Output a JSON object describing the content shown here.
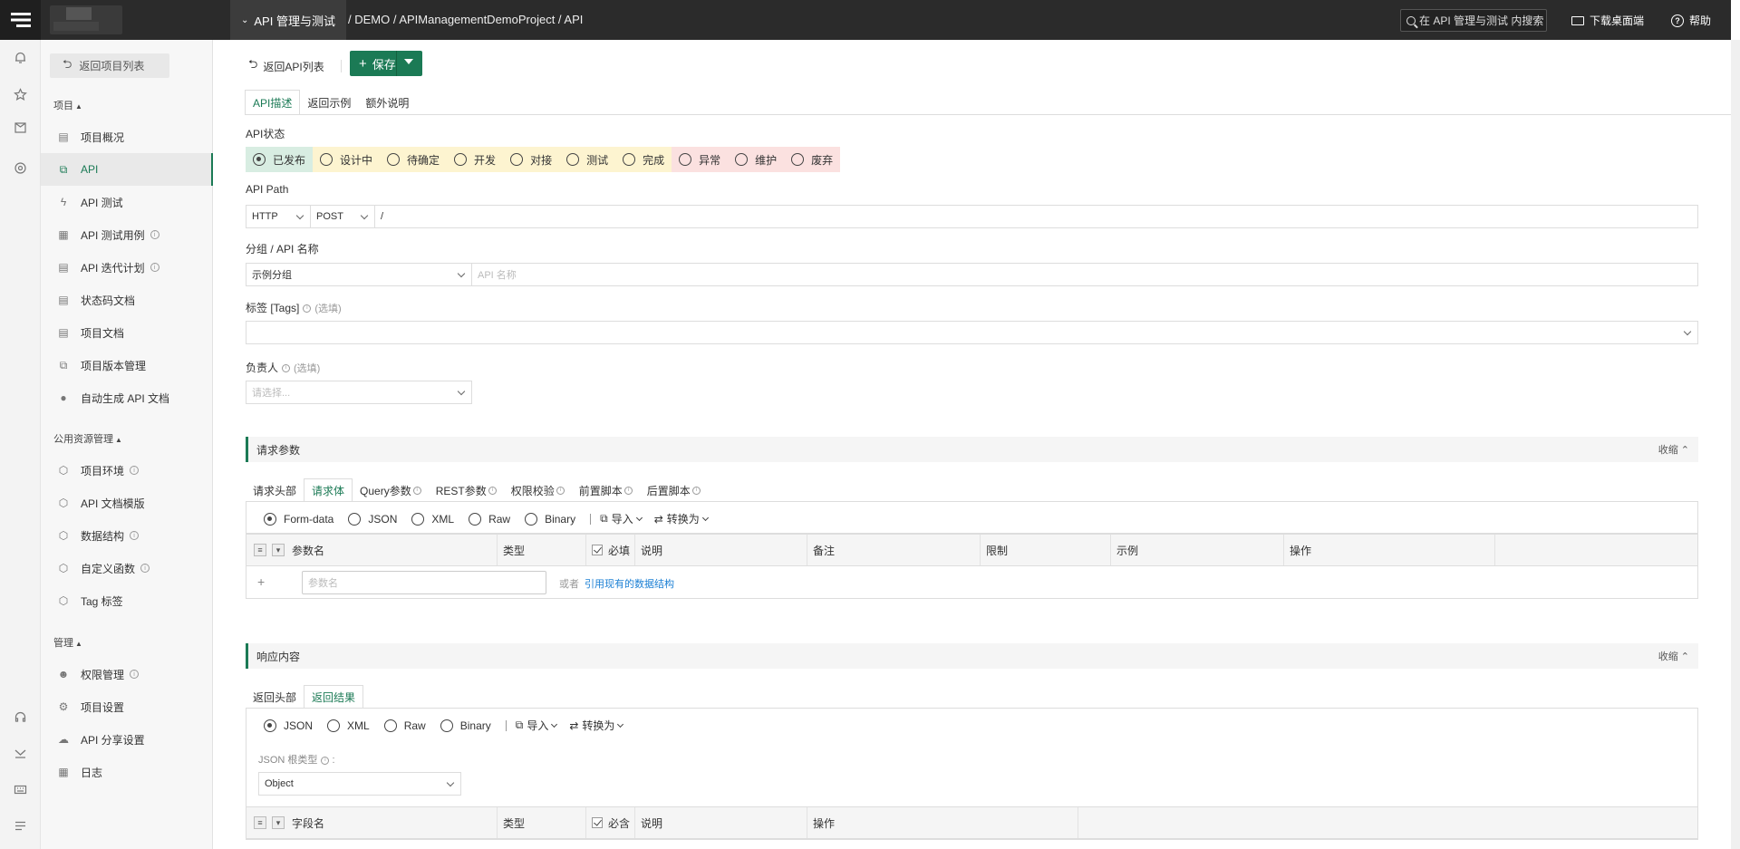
{
  "topbar": {
    "project_selector": "API 管理与测试",
    "breadcrumb": "/ DEMO / APIManagementDemoProject / API",
    "search_placeholder": "在 API 管理与测试 内搜索",
    "download": "下载桌面端",
    "help": "帮助"
  },
  "sidebar": {
    "back_label": "返回项目列表",
    "sections": [
      {
        "title": "项目"
      },
      {
        "title": "公用资源管理"
      },
      {
        "title": "管理"
      }
    ],
    "items": [
      {
        "label": "项目概况"
      },
      {
        "label": "API"
      },
      {
        "label": "API 测试"
      },
      {
        "label": "API 测试用例"
      },
      {
        "label": "API 迭代计划"
      },
      {
        "label": "状态码文档"
      },
      {
        "label": "项目文档"
      },
      {
        "label": "项目版本管理"
      },
      {
        "label": "自动生成 API 文档"
      },
      {
        "label": "项目环境"
      },
      {
        "label": "API 文档模版"
      },
      {
        "label": "数据结构"
      },
      {
        "label": "自定义函数"
      },
      {
        "label": "Tag 标签"
      },
      {
        "label": "权限管理"
      },
      {
        "label": "项目设置"
      },
      {
        "label": "API 分享设置"
      },
      {
        "label": "日志"
      }
    ]
  },
  "toolbar": {
    "back_api": "返回API列表",
    "save": "保存"
  },
  "tabs": [
    "API描述",
    "返回示例",
    "额外说明"
  ],
  "form": {
    "status_label": "API状态",
    "statuses": [
      "已发布",
      "设计中",
      "待确定",
      "开发",
      "对接",
      "测试",
      "完成",
      "异常",
      "维护",
      "废弃"
    ],
    "path_label": "API Path",
    "protocol": "HTTP",
    "method": "POST",
    "path": "/",
    "group_label": "分组 / API 名称",
    "group_value": "示例分组",
    "name_placeholder": "API 名称",
    "tags_label": "标签 [Tags]",
    "optional": "(选填)",
    "owner_label": "负责人",
    "owner_placeholder": "请选择..."
  },
  "request": {
    "title": "请求参数",
    "collapse": "收缩",
    "tabs": [
      "请求头部",
      "请求体",
      "Query参数",
      "REST参数",
      "权限校验",
      "前置脚本",
      "后置脚本"
    ],
    "formats": [
      "Form-data",
      "JSON",
      "XML",
      "Raw",
      "Binary"
    ],
    "import": "导入",
    "convert": "转换为",
    "columns": [
      "参数名",
      "类型",
      "必填",
      "说明",
      "备注",
      "限制",
      "示例",
      "操作"
    ],
    "param_placeholder": "参数名",
    "or_text": "或者",
    "ref_link": "引用现有的数据结构"
  },
  "response": {
    "title": "响应内容",
    "collapse": "收缩",
    "tabs": [
      "返回头部",
      "返回结果"
    ],
    "formats": [
      "JSON",
      "XML",
      "Raw",
      "Binary"
    ],
    "import": "导入",
    "convert": "转换为",
    "root_type_label": "JSON 根类型",
    "root_type": "Object",
    "columns": [
      "字段名",
      "类型",
      "必含",
      "说明",
      "操作"
    ]
  }
}
